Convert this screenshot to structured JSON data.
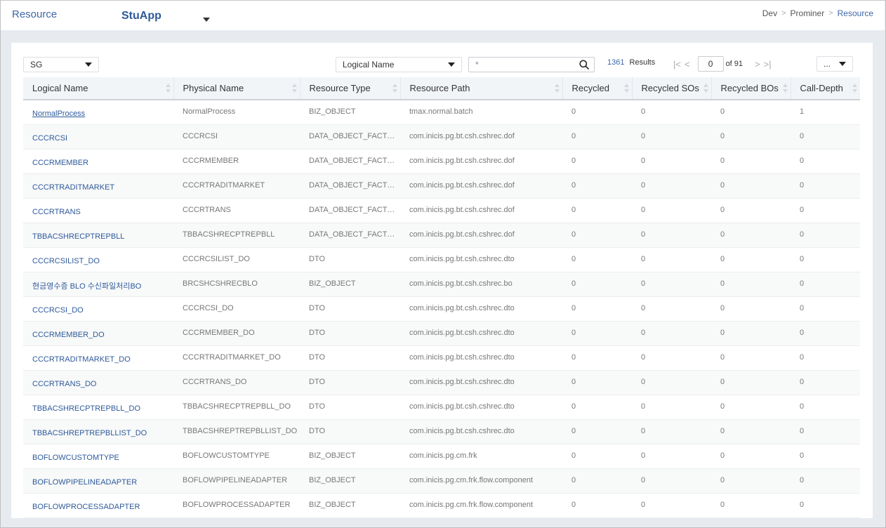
{
  "header": {
    "title": "Resource",
    "app_selector": "StuApp",
    "breadcrumb": [
      "Dev",
      "Prominer",
      "Resource"
    ],
    "breadcrumb_separator": ">"
  },
  "toolbar": {
    "group_select": "SG",
    "field_select": "Logical Name",
    "search_value": "*",
    "results_count": "1361",
    "results_label": "Results",
    "page_value": "0",
    "page_total": "of 91",
    "more_select": "..."
  },
  "colors": {
    "accent": "#3e67a8",
    "link": "#2e5a9a",
    "header_bg": "#f2f5f8",
    "page_bg": "#e7ebf0"
  },
  "table": {
    "columns": [
      "Logical Name",
      "Physical Name",
      "Resource Type",
      "Resource Path",
      "Recycled",
      "Recycled SOs",
      "Recycled BOs",
      "Call-Depth"
    ],
    "rows": [
      [
        "NormalProcess",
        "NormalProcess",
        "BIZ_OBJECT",
        "tmax.normal.batch",
        "0",
        "0",
        "0",
        "1"
      ],
      [
        "CCCRCSI",
        "CCCRCSI",
        "DATA_OBJECT_FACTORY",
        "com.inicis.pg.bt.csh.cshrec.dof",
        "0",
        "0",
        "0",
        "0"
      ],
      [
        "CCCRMEMBER",
        "CCCRMEMBER",
        "DATA_OBJECT_FACTORY",
        "com.inicis.pg.bt.csh.cshrec.dof",
        "0",
        "0",
        "0",
        "0"
      ],
      [
        "CCCRTRADITMARKET",
        "CCCRTRADITMARKET",
        "DATA_OBJECT_FACTORY",
        "com.inicis.pg.bt.csh.cshrec.dof",
        "0",
        "0",
        "0",
        "0"
      ],
      [
        "CCCRTRANS",
        "CCCRTRANS",
        "DATA_OBJECT_FACTORY",
        "com.inicis.pg.bt.csh.cshrec.dof",
        "0",
        "0",
        "0",
        "0"
      ],
      [
        "TBBACSHRECPTREPBLL",
        "TBBACSHRECPTREPBLL",
        "DATA_OBJECT_FACTORY",
        "com.inicis.pg.bt.csh.cshrec.dof",
        "0",
        "0",
        "0",
        "0"
      ],
      [
        "CCCRCSILIST_DO",
        "CCCRCSILIST_DO",
        "DTO",
        "com.inicis.pg.bt.csh.cshrec.dto",
        "0",
        "0",
        "0",
        "0"
      ],
      [
        "현금영수증 BLO 수신파일처리BO",
        "BRCSHCSHRECBLO",
        "BIZ_OBJECT",
        "com.inicis.pg.bt.csh.cshrec.bo",
        "0",
        "0",
        "0",
        "0"
      ],
      [
        "CCCRCSI_DO",
        "CCCRCSI_DO",
        "DTO",
        "com.inicis.pg.bt.csh.cshrec.dto",
        "0",
        "0",
        "0",
        "0"
      ],
      [
        "CCCRMEMBER_DO",
        "CCCRMEMBER_DO",
        "DTO",
        "com.inicis.pg.bt.csh.cshrec.dto",
        "0",
        "0",
        "0",
        "0"
      ],
      [
        "CCCRTRADITMARKET_DO",
        "CCCRTRADITMARKET_DO",
        "DTO",
        "com.inicis.pg.bt.csh.cshrec.dto",
        "0",
        "0",
        "0",
        "0"
      ],
      [
        "CCCRTRANS_DO",
        "CCCRTRANS_DO",
        "DTO",
        "com.inicis.pg.bt.csh.cshrec.dto",
        "0",
        "0",
        "0",
        "0"
      ],
      [
        "TBBACSHRECPTREPBLL_DO",
        "TBBACSHRECPTREPBLL_DO",
        "DTO",
        "com.inicis.pg.bt.csh.cshrec.dto",
        "0",
        "0",
        "0",
        "0"
      ],
      [
        "TBBACSHREPTREPBLLIST_DO",
        "TBBACSHREPTREPBLLIST_DO",
        "DTO",
        "com.inicis.pg.bt.csh.cshrec.dto",
        "0",
        "0",
        "0",
        "0"
      ],
      [
        "BOFLOWCUSTOMTYPE",
        "BOFLOWCUSTOMTYPE",
        "BIZ_OBJECT",
        "com.inicis.pg.cm.frk",
        "0",
        "0",
        "0",
        "0"
      ],
      [
        "BOFLOWPIPELINEADAPTER",
        "BOFLOWPIPELINEADAPTER",
        "BIZ_OBJECT",
        "com.inicis.pg.cm.frk.flow.component",
        "0",
        "0",
        "0",
        "0"
      ],
      [
        "BOFLOWPROCESSADAPTER",
        "BOFLOWPROCESSADAPTER",
        "BIZ_OBJECT",
        "com.inicis.pg.cm.frk.flow.component",
        "0",
        "0",
        "0",
        "0"
      ]
    ]
  }
}
